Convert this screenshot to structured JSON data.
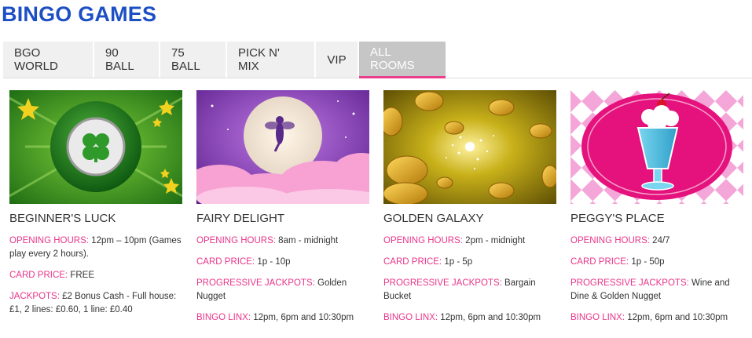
{
  "page": {
    "title": "BINGO GAMES"
  },
  "tabs": [
    {
      "label": "BGO WORLD"
    },
    {
      "label": "90 BALL"
    },
    {
      "label": "75 BALL"
    },
    {
      "label": "PICK N' MIX"
    },
    {
      "label": "VIP"
    },
    {
      "label": "ALL ROOMS",
      "active": true
    }
  ],
  "rooms": [
    {
      "name": "BEGINNER'S LUCK",
      "opening_label": "OPENING HOURS:",
      "opening": "12pm – 10pm (Games play every 2 hours).",
      "card_label": "CARD PRICE:",
      "card": "FREE",
      "jackpot_label": "JACKPOTS:",
      "jackpot": "£2 Bonus Cash - Full house: £1, 2 lines: £0.60, 1 line: £0.40"
    },
    {
      "name": "FAIRY DELIGHT",
      "opening_label": "OPENING HOURS:",
      "opening": "8am - midnight",
      "card_label": "CARD PRICE:",
      "card": "1p - 10p",
      "jackpot_label": "PROGRESSIVE JACKPOTS:",
      "jackpot": "Golden Nugget",
      "linx_label": "BINGO LINX:",
      "linx": "12pm, 6pm and 10:30pm"
    },
    {
      "name": "GOLDEN GALAXY",
      "opening_label": "OPENING HOURS:",
      "opening": "2pm - midnight",
      "card_label": "CARD PRICE:",
      "card": "1p - 5p",
      "jackpot_label": "PROGRESSIVE JACKPOTS:",
      "jackpot": "Bargain Bucket",
      "linx_label": "BINGO LINX:",
      "linx": "12pm, 6pm and 10:30pm"
    },
    {
      "name": "PEGGY'S PLACE",
      "opening_label": "OPENING HOURS:",
      "opening": "24/7",
      "card_label": "CARD PRICE:",
      "card": "1p - 50p",
      "jackpot_label": "PROGRESSIVE JACKPOTS:",
      "jackpot": "Wine and Dine & Golden Nugget",
      "linx_label": "BINGO LINX:",
      "linx": "12pm, 6pm and 10:30pm"
    }
  ],
  "colors": {
    "title": "#1d4fc4",
    "label_pink": "#e8358a",
    "tab_active_bg": "#c6c6c6",
    "tab_underline": "#e83e8c"
  },
  "icons": [
    "clover-ball-icon",
    "fairy-moon-icon",
    "gold-coins-icon",
    "milkshake-icon"
  ]
}
